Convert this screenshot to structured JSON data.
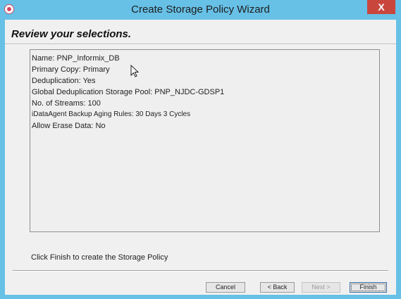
{
  "window": {
    "title": "Create Storage Policy Wizard",
    "close_glyph": "X",
    "icon": "app-icon"
  },
  "page": {
    "heading": "Review your selections.",
    "summary": [
      "Name: PNP_Informix_DB",
      "Primary Copy: Primary",
      "Deduplication: Yes",
      "Global Deduplication Storage Pool:  PNP_NJDC-GDSP1",
      "No. of Streams: 100",
      "iDataAgent Backup Aging Rules: 30 Days 3 Cycles",
      "Allow Erase Data:  No"
    ],
    "hint": "Click Finish to create the Storage Policy"
  },
  "buttons": {
    "cancel": "Cancel",
    "back": "< Back",
    "next": "Next >",
    "finish": "Finish"
  },
  "colors": {
    "titlebar": "#67c0e6",
    "close": "#c9463d",
    "background": "#f0f0f0"
  }
}
